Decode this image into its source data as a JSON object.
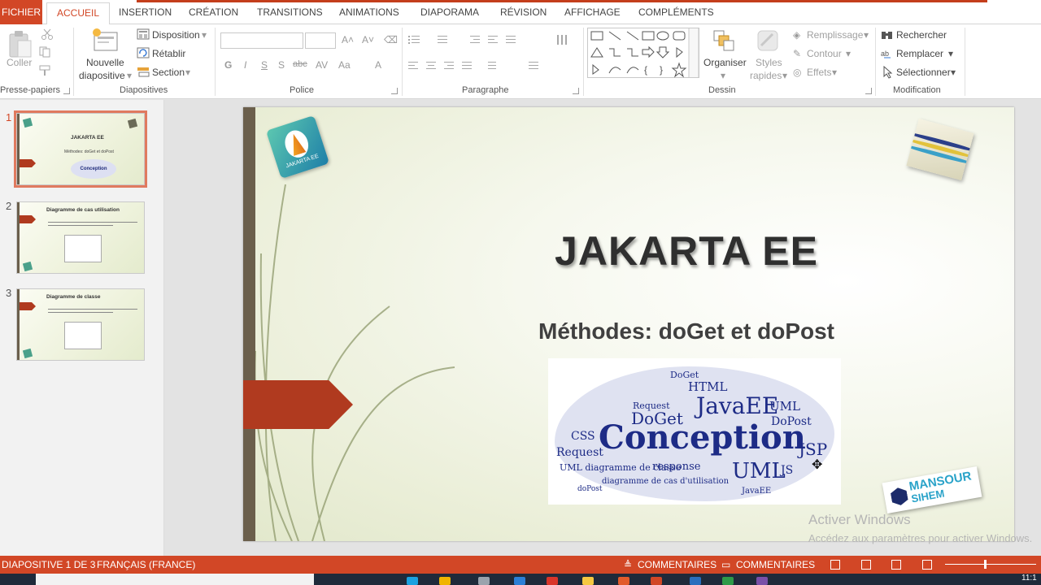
{
  "tabs": {
    "file": "FICHIER",
    "items": [
      "ACCUEIL",
      "INSERTION",
      "CRÉATION",
      "TRANSITIONS",
      "ANIMATIONS",
      "DIAPORAMA",
      "RÉVISION",
      "AFFICHAGE",
      "COMPLÉMENTS"
    ],
    "active": "ACCUEIL"
  },
  "ribbon": {
    "clipboard": {
      "paste": "Coller",
      "label": "Presse-papiers"
    },
    "slides": {
      "new_slide_1": "Nouvelle",
      "new_slide_2": "diapositive",
      "layout": "Disposition",
      "reset": "Rétablir",
      "section": "Section",
      "label": "Diapositives"
    },
    "font": {
      "bold": "G",
      "italic": "I",
      "underline": "S",
      "shadow": "S",
      "strike": "abc",
      "spacing": "AV",
      "case": "Aa",
      "color": "A",
      "label": "Police"
    },
    "paragraph": {
      "label": "Paragraphe"
    },
    "drawing": {
      "arrange": "Organiser",
      "styles_1": "Styles",
      "styles_2": "rapides",
      "fill": "Remplissage",
      "outline": "Contour",
      "effects": "Effets",
      "label": "Dessin"
    },
    "editing": {
      "find": "Rechercher",
      "replace": "Remplacer",
      "select": "Sélectionner",
      "label": "Modification"
    }
  },
  "thumbnails": [
    {
      "number": "1",
      "title": "JAKARTA EE",
      "subtitle": "Méthodes: doGet et doPost",
      "cloud": "Conception"
    },
    {
      "number": "2",
      "title": "Diagramme de cas utilisation"
    },
    {
      "number": "3",
      "title": "Diagramme de classe"
    }
  ],
  "slide": {
    "title": "JAKARTA EE",
    "subtitle": "Méthodes: doGet et doPost",
    "logo_text": "JAKARTA EE",
    "brand_1": "MANSOUR",
    "brand_2": "SIHEM",
    "word_cloud": [
      "DoGet",
      "HTML",
      "JavaEE",
      "Request",
      "UML",
      "DoPost",
      "Conception",
      "CSS",
      "JSP",
      "JS",
      "response",
      "UML diagramme de classe",
      "diagramme de cas d'utilisation",
      "doPost"
    ]
  },
  "watermark": {
    "line1": "Activer Windows",
    "line2": "Accédez aux paramètres pour activer Windows."
  },
  "status": {
    "slide_info": "DIAPOSITIVE 1 DE 3",
    "language": "FRANÇAIS (FRANCE)",
    "notes": "COMMENTAIRES",
    "comments": "COMMENTAIRES"
  },
  "taskbar": {
    "clock": "11:1"
  },
  "colors": {
    "accent": "#d24726",
    "slide_bar": "#6b5f4c",
    "flag": "#b03a1f",
    "cloud_text": "#1d2b86"
  },
  "icons": [
    "cut-icon",
    "copy-icon",
    "format-painter-icon",
    "new-slide-icon",
    "layout-icon",
    "reset-icon",
    "section-icon",
    "bullets-icon",
    "numbering-icon",
    "shapes-icon",
    "arrange-icon",
    "quick-styles-icon",
    "find-icon",
    "replace-icon",
    "select-icon"
  ]
}
